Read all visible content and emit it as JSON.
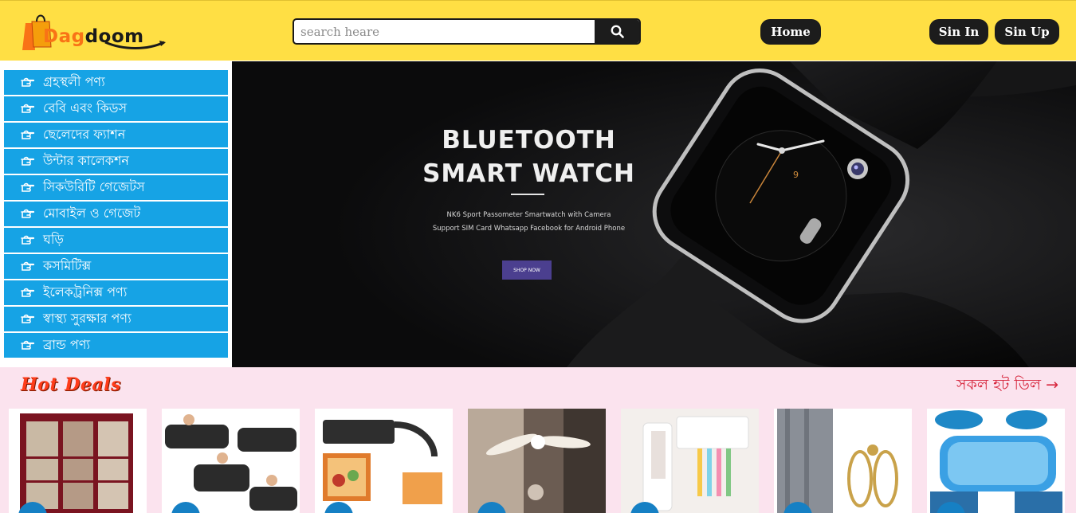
{
  "header": {
    "logo_text_a": "Dag",
    "logo_text_b": "doom",
    "search_placeholder": "search heare",
    "nav": {
      "home": "Home",
      "sign_in": "Sin In",
      "sign_up": "Sin Up"
    }
  },
  "sidebar": {
    "items": [
      {
        "label": "গ্রহস্থলী পণ্য"
      },
      {
        "label": "বেবি এবং কিডস"
      },
      {
        "label": "ছেলেদের ফ্যাশন"
      },
      {
        "label": "উন্টার কালেকশন"
      },
      {
        "label": "সিকউরিটি গেজেটস"
      },
      {
        "label": "মোবাইল ও গেজেট"
      },
      {
        "label": "ঘড়ি"
      },
      {
        "label": "কসমিটিক্স"
      },
      {
        "label": "ইলেকট্রনিক্স পণ্য"
      },
      {
        "label": "স্বাস্থ্য সুরক্ষার পণ্য"
      },
      {
        "label": "ব্রান্ড পণ্য"
      }
    ]
  },
  "banner": {
    "title_line1": "BLUETOOTH",
    "title_line2": "SMART WATCH",
    "subtitle_line1": "NK6 Sport Passometer Smartwatch with Camera",
    "subtitle_line2": "Support SIM Card Whatsapp Facebook for Android Phone",
    "button": "SHOP NOW",
    "watch_numeral": "9"
  },
  "deals": {
    "title": "Hot Deals",
    "all_link": "সকল হট ডিল",
    "arrow": "→",
    "products": [
      {
        "name": "wardrobe"
      },
      {
        "name": "inflatable-sofa"
      },
      {
        "name": "vegetable-chopper"
      },
      {
        "name": "folding-fan-light"
      },
      {
        "name": "toothbrush-holder"
      },
      {
        "name": "curtain-tieback"
      },
      {
        "name": "gel-seat-cushion"
      }
    ]
  },
  "colors": {
    "header_bg": "#ffdf44",
    "sidebar_item": "#16a3e5",
    "deals_bg": "#fbe3ee",
    "dark_button": "#1c1c1c",
    "hot_deals": "#ff3c1a",
    "all_deals_link": "#d7263d"
  }
}
